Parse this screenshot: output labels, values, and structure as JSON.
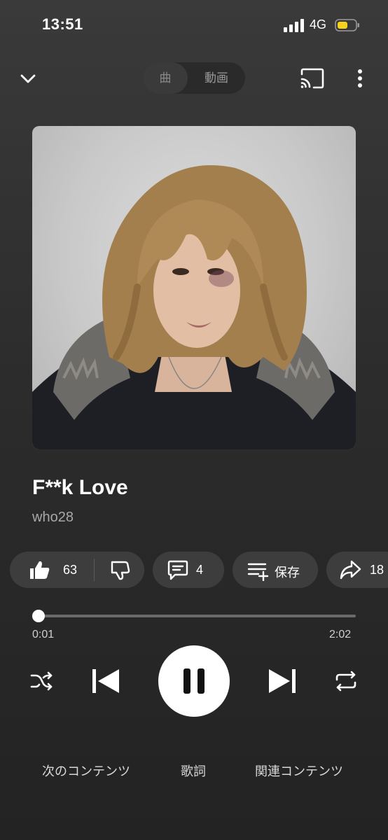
{
  "status": {
    "time": "13:51",
    "network": "4G"
  },
  "header": {
    "tab_song": "曲",
    "tab_video": "動画"
  },
  "track": {
    "title": "F**k Love",
    "artist": "who28"
  },
  "actions": {
    "likes": "63",
    "comments": "4",
    "save_label": "保存",
    "shares": "18"
  },
  "player": {
    "current_time": "0:01",
    "duration": "2:02",
    "progress": 0.008
  },
  "tabs": [
    "次のコンテンツ",
    "歌詞",
    "関連コンテンツ"
  ],
  "colors": {
    "background": "#2c2c2c",
    "chip": "#3d3d3d",
    "battery": "#f7d21c"
  },
  "icons": [
    "chevron-down-icon",
    "cast-icon",
    "more-vert-icon",
    "thumb-up-icon",
    "thumb-down-icon",
    "comment-icon",
    "playlist-add-icon",
    "share-icon",
    "shuffle-icon",
    "previous-icon",
    "pause-icon",
    "next-icon",
    "repeat-icon"
  ]
}
